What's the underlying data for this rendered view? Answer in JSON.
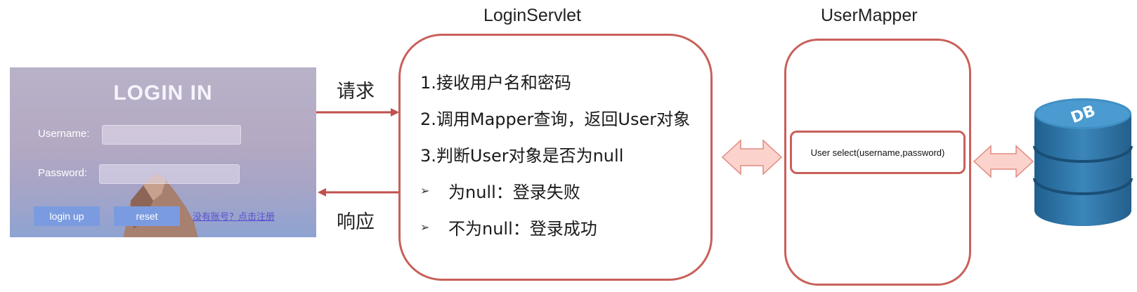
{
  "login_panel": {
    "title": "LOGIN IN",
    "username_label": "Username:",
    "password_label": "Password:",
    "login_button": "login up",
    "reset_button": "reset",
    "register_link": "没有账号？点击注册"
  },
  "arrows": {
    "request_label": "请求",
    "response_label": "响应"
  },
  "servlet": {
    "title": "LoginServlet",
    "steps": [
      "1.接收用户名和密码",
      "2.调用Mapper查询，返回User对象",
      "3.判断User对象是否为null"
    ],
    "bullets": [
      "为null：登录失败",
      "不为null：登录成功"
    ],
    "bullet_glyph": "➢"
  },
  "mapper": {
    "title": "UserMapper",
    "method": "User select(username,password)"
  },
  "database": {
    "label": "DB"
  },
  "colors": {
    "box_border": "#c9605a",
    "arrow_line": "#c0504d",
    "double_arrow_fill": "#fbd3cc",
    "db_blue": "#2a6f9f"
  }
}
